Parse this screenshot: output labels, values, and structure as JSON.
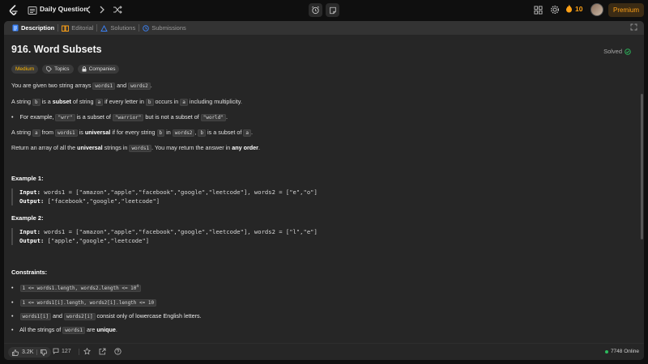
{
  "topbar": {
    "title": "Daily Question",
    "streak_count": "10",
    "premium_label": "Premium"
  },
  "tabs": [
    {
      "label": "Description",
      "icon": "description-icon"
    },
    {
      "label": "Editorial",
      "icon": "editorial-icon"
    },
    {
      "label": "Solutions",
      "icon": "solutions-icon"
    },
    {
      "label": "Submissions",
      "icon": "submissions-icon"
    }
  ],
  "problem": {
    "title": "916. Word Subsets",
    "status": "Solved",
    "difficulty": "Medium",
    "topics_label": "Topics",
    "companies_label": "Companies"
  },
  "description": {
    "p1_a": "You are given two string arrays ",
    "p1_code1": "words1",
    "p1_b": " and ",
    "p1_code2": "words2",
    "p1_c": ".",
    "p2_a": "A string ",
    "p2_code1": "b",
    "p2_b": " is a ",
    "p2_bold": "subset",
    "p2_c": " of string ",
    "p2_code2": "a",
    "p2_d": " if every letter in ",
    "p2_code3": "b",
    "p2_e": " occurs in ",
    "p2_code4": "a",
    "p2_f": " including multiplicity.",
    "bullet1_a": "For example, ",
    "bullet1_code1": "\"wrr\"",
    "bullet1_b": " is a subset of ",
    "bullet1_code2": "\"warrior\"",
    "bullet1_c": " but is not a subset of ",
    "bullet1_code3": "\"world\"",
    "bullet1_d": ".",
    "p3_a": "A string ",
    "p3_code1": "a",
    "p3_b": " from ",
    "p3_code2": "words1",
    "p3_c": " is ",
    "p3_bold": "universal",
    "p3_d": " if for every string ",
    "p3_code3": "b",
    "p3_e": " in ",
    "p3_code4": "words2",
    "p3_f": ", ",
    "p3_code5": "b",
    "p3_g": " is a subset of ",
    "p3_code6": "a",
    "p3_h": ".",
    "p4_a": "Return an array of all the ",
    "p4_bold1": "universal",
    "p4_b": " strings in ",
    "p4_code1": "words1",
    "p4_c": ". You may return the answer in ",
    "p4_bold2": "any order",
    "p4_d": "."
  },
  "examples": [
    {
      "title": "Example 1:",
      "input_label": "Input:",
      "input": " words1 = [\"amazon\",\"apple\",\"facebook\",\"google\",\"leetcode\"], words2 = [\"e\",\"o\"]",
      "output_label": "Output:",
      "output": " [\"facebook\",\"google\",\"leetcode\"]"
    },
    {
      "title": "Example 2:",
      "input_label": "Input:",
      "input": " words1 = [\"amazon\",\"apple\",\"facebook\",\"google\",\"leetcode\"], words2 = [\"l\",\"e\"]",
      "output_label": "Output:",
      "output": " [\"apple\",\"google\",\"leetcode\"]"
    }
  ],
  "constraints": {
    "title": "Constraints:",
    "c1_code": "1 <= words1.length, words2.length <= 10",
    "c1_sup": "4",
    "c2_code": "1 <= words1[i].length, words2[i].length <= 10",
    "c3_code1": "words1[i]",
    "c3_a": " and ",
    "c3_code2": "words2[i]",
    "c3_b": " consist only of lowercase English letters.",
    "c4_a": "All the strings of ",
    "c4_code": "words1",
    "c4_b": " are ",
    "c4_bold": "unique",
    "c4_c": "."
  },
  "bottombar": {
    "likes": "3.2K",
    "comments": "127",
    "online": "7748 Online"
  }
}
